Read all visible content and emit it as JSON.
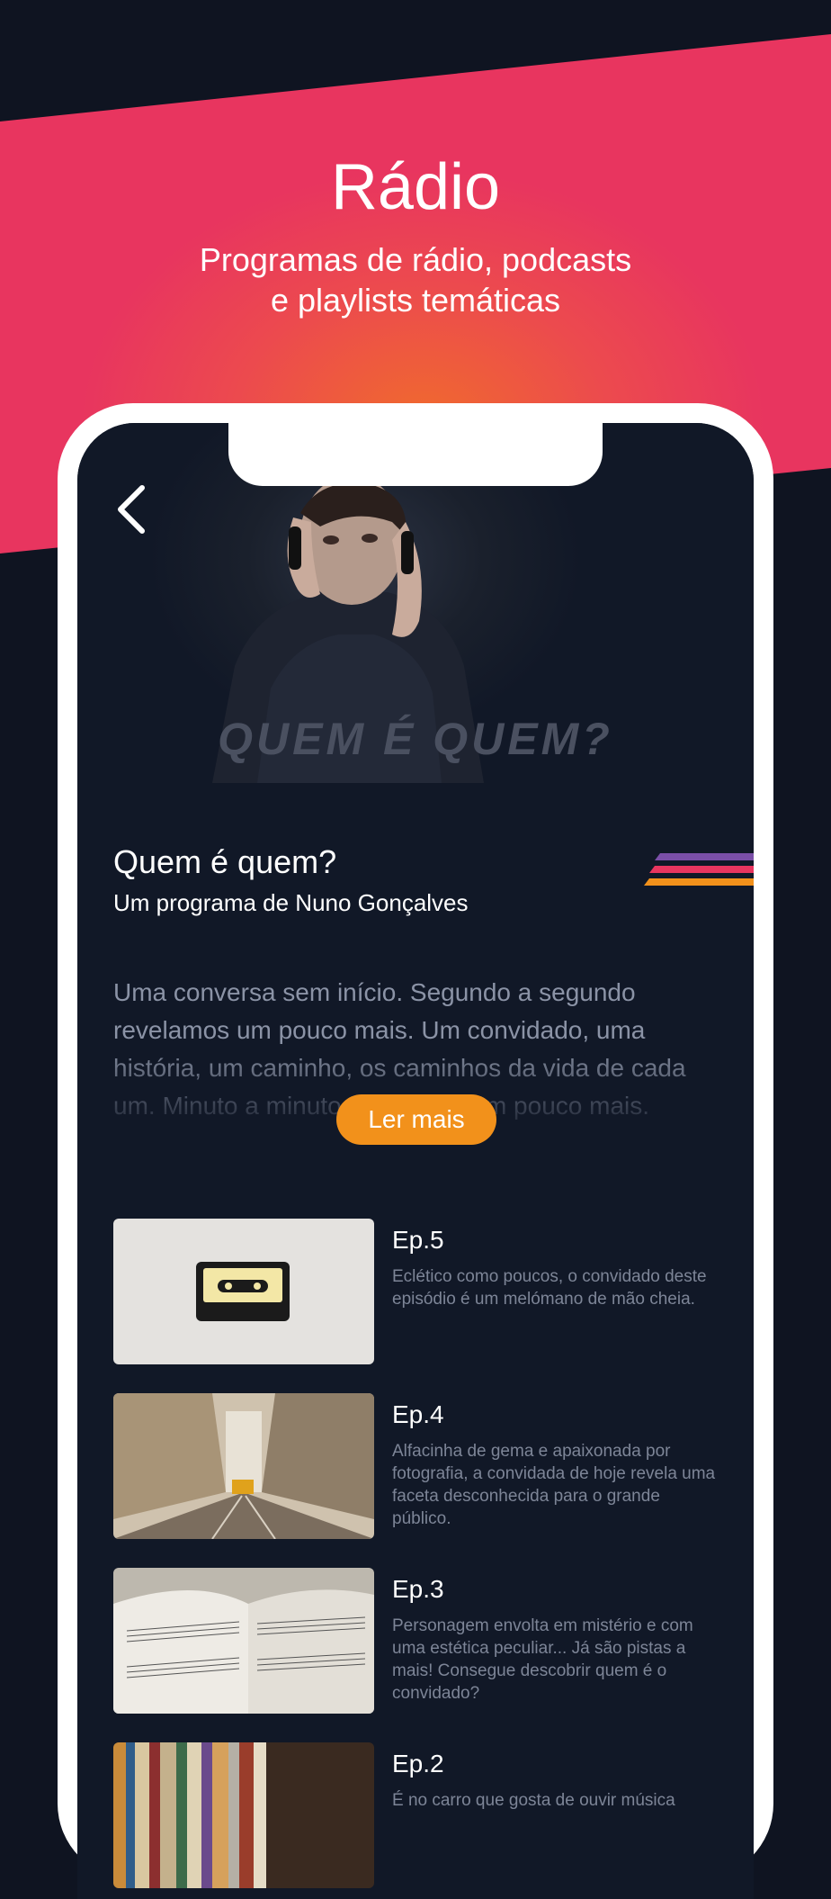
{
  "banner": {
    "title": "Rádio",
    "subtitle_line1": "Programas de rádio, podcasts",
    "subtitle_line2": "e playlists temáticas"
  },
  "show": {
    "logo_text": "QUEM É QUEM?",
    "title": "Quem é quem?",
    "subtitle": "Um programa de Nuno Gonçalves",
    "description": "Uma conversa sem início. Segundo a segundo revelamos um pouco mais. Um convidado, uma história, um caminho, os caminhos da vida de cada um. Minuto a minuto revelamos um pouco mais.",
    "read_more": "Ler mais"
  },
  "episodes": [
    {
      "title": "Ep.5",
      "description": "Eclético como poucos, o convidado deste episódio é um melómano de mão cheia.",
      "thumb_icon": "cassette-image"
    },
    {
      "title": "Ep.4",
      "description": "Alfacinha de gema e apaixonada por fotografia, a convidada de hoje revela uma faceta desconhecida para o grande público.",
      "thumb_icon": "street-tram-image"
    },
    {
      "title": "Ep.3",
      "description": "Personagem envolta em mistério e com uma estética peculiar... Já são pistas a mais! Consegue descobrir quem é o convidado?",
      "thumb_icon": "sheet-music-image"
    },
    {
      "title": "Ep.2",
      "description": "É no carro que gosta de ouvir música",
      "thumb_icon": "records-image"
    }
  ],
  "colors": {
    "banner_pink": "#e8355f",
    "banner_orange": "#f06a2e",
    "background": "#0f1421",
    "accent_orange": "#f2911b",
    "stripe_purple": "#7b4fa8",
    "stripe_pink": "#e8355f",
    "stripe_orange": "#f2911b"
  }
}
